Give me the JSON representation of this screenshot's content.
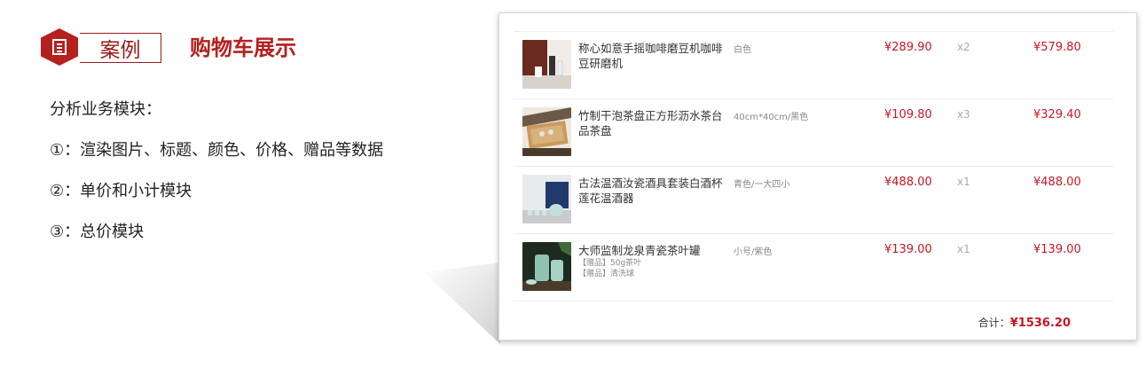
{
  "header": {
    "case_label": "案例",
    "title": "购物车展示"
  },
  "bullets": [
    "分析业务模块：",
    "①：渲染图片、标题、颜色、价格、赠品等数据",
    "②：单价和小计模块",
    "③：总价模块"
  ],
  "cart": {
    "items": [
      {
        "name": "称心如意手摇咖啡磨豆机咖啡豆研磨机",
        "gifts": [],
        "color": "白色",
        "price": "¥289.90",
        "qty": "x2",
        "subtotal": "¥579.80"
      },
      {
        "name": "竹制干泡茶盘正方形沥水茶台品茶盘",
        "gifts": [],
        "color": "40cm*40cm/黑色",
        "price": "¥109.80",
        "qty": "x3",
        "subtotal": "¥329.40"
      },
      {
        "name": "古法温酒汝瓷酒具套装白酒杯莲花温酒器",
        "gifts": [],
        "color": "青色/一大四小",
        "price": "¥488.00",
        "qty": "x1",
        "subtotal": "¥488.00"
      },
      {
        "name": "大师监制龙泉青瓷茶叶罐",
        "gifts": [
          "【赠品】50g茶叶",
          "【赠品】清洗球"
        ],
        "color": "小号/紫色",
        "price": "¥139.00",
        "qty": "x1",
        "subtotal": "¥139.00"
      }
    ],
    "total_label": "合计：",
    "total_value": "¥1536.20"
  },
  "colors": {
    "accent": "#b4211e",
    "price": "#c81623"
  },
  "icons": {
    "case": "document-icon"
  }
}
